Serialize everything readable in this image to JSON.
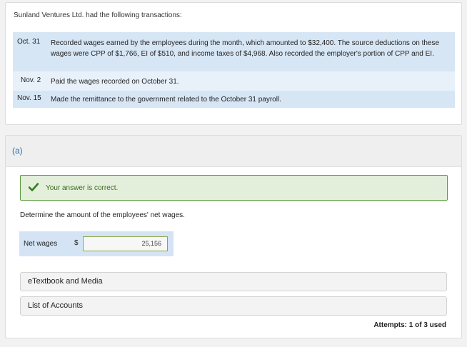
{
  "problem": {
    "intro": "Sunland Ventures Ltd. had the following transactions:",
    "transactions": [
      {
        "date": "Oct. 31",
        "description": "Recorded wages earned by the employees during the month, which amounted to $32,400. The source deductions on these wages were CPP of $1,766, EI of $510, and income taxes of $4,968. Also recorded the employer's portion of CPP and EI."
      },
      {
        "date": "Nov. 2",
        "description": "Paid the wages recorded on October 31."
      },
      {
        "date": "Nov. 15",
        "description": "Made the remittance to the government related to the October 31 payroll."
      }
    ]
  },
  "part": {
    "label": "(a)",
    "feedback": "Your answer is correct.",
    "question": "Determine the amount of the employees' net wages.",
    "answer_label": "Net wages",
    "currency": "$",
    "answer_value": "25,156",
    "links": [
      "eTextbook and Media",
      "List of Accounts"
    ],
    "attempts": "Attempts: 1 of 3 used"
  }
}
